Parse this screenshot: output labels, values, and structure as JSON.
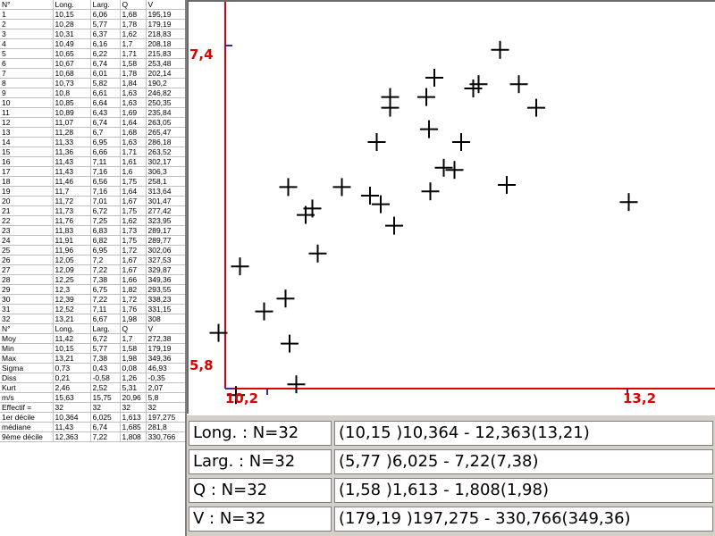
{
  "table": {
    "header": [
      "N°",
      "Long.",
      "Larg.",
      "Q",
      "V"
    ],
    "rows": [
      [
        "1",
        "10,15",
        "6,06",
        "1,68",
        "195,19"
      ],
      [
        "2",
        "10,28",
        "5,77",
        "1,78",
        "179,19"
      ],
      [
        "3",
        "10,31",
        "6,37",
        "1,62",
        "218,83"
      ],
      [
        "4",
        "10,49",
        "6,16",
        "1,7",
        "208,18"
      ],
      [
        "5",
        "10,65",
        "6,22",
        "1,71",
        "215,83"
      ],
      [
        "6",
        "10,67",
        "6,74",
        "1,58",
        "253,48"
      ],
      [
        "7",
        "10,68",
        "6,01",
        "1,78",
        "202,14"
      ],
      [
        "8",
        "10,73",
        "5,82",
        "1,84",
        "190,2"
      ],
      [
        "9",
        "10,8",
        "6,61",
        "1,63",
        "246,82"
      ],
      [
        "10",
        "10,85",
        "6,64",
        "1,63",
        "250,35"
      ],
      [
        "11",
        "10,89",
        "6,43",
        "1,69",
        "235,84"
      ],
      [
        "12",
        "11,07",
        "6,74",
        "1,64",
        "263,05"
      ],
      [
        "13",
        "11,28",
        "6,7",
        "1,68",
        "265,47"
      ],
      [
        "14",
        "11,33",
        "6,95",
        "1,63",
        "286,18"
      ],
      [
        "15",
        "11,36",
        "6,66",
        "1,71",
        "263,52"
      ],
      [
        "16",
        "11,43",
        "7,11",
        "1,61",
        "302,17"
      ],
      [
        "17",
        "11,43",
        "7,16",
        "1,6",
        "306,3"
      ],
      [
        "18",
        "11,46",
        "6,56",
        "1,75",
        "258,1"
      ],
      [
        "19",
        "11,7",
        "7,16",
        "1,64",
        "313,64"
      ],
      [
        "20",
        "11,72",
        "7,01",
        "1,67",
        "301,47"
      ],
      [
        "21",
        "11,73",
        "6,72",
        "1,75",
        "277,42"
      ],
      [
        "22",
        "11,76",
        "7,25",
        "1,62",
        "323,95"
      ],
      [
        "23",
        "11,83",
        "6,83",
        "1,73",
        "289,17"
      ],
      [
        "24",
        "11,91",
        "6,82",
        "1,75",
        "289,77"
      ],
      [
        "25",
        "11,96",
        "6,95",
        "1,72",
        "302,06"
      ],
      [
        "26",
        "12,05",
        "7,2",
        "1,67",
        "327,53"
      ],
      [
        "27",
        "12,09",
        "7,22",
        "1,67",
        "329,87"
      ],
      [
        "28",
        "12,25",
        "7,38",
        "1,66",
        "349,36"
      ],
      [
        "29",
        "12,3",
        "6,75",
        "1,82",
        "293,55"
      ],
      [
        "30",
        "12,39",
        "7,22",
        "1,72",
        "338,23"
      ],
      [
        "31",
        "12,52",
        "7,11",
        "1,76",
        "331,15"
      ],
      [
        "32",
        "13,21",
        "6,67",
        "1,98",
        "308"
      ],
      [
        "N°",
        "Long.",
        "Larg.",
        "Q",
        "V"
      ],
      [
        "Moy",
        "11,42",
        "6,72",
        "1,7",
        "272,38"
      ],
      [
        "Min",
        "10,15",
        "5,77",
        "1,58",
        "179,19"
      ],
      [
        "Max",
        "13,21",
        "7,38",
        "1,98",
        "349,36"
      ],
      [
        "Sigma",
        "0,73",
        "0,43",
        "0,08",
        "46,93"
      ],
      [
        "Diss",
        "0,21",
        "-0,58",
        "1,26",
        "-0,35"
      ],
      [
        "Kurt",
        "2,46",
        "2,52",
        "5,31",
        "2,07"
      ],
      [
        "m/s",
        "15,63",
        "15,75",
        "20,96",
        "5,8"
      ],
      [
        "Effectif =",
        "32",
        "32",
        "32",
        "32"
      ],
      [
        "1er décile",
        "10,364",
        "6,025",
        "1,613",
        "197,275"
      ],
      [
        "médiane",
        "11,43",
        "6,74",
        "1,685",
        "281,8"
      ],
      [
        "9ème décile",
        "12,363",
        "7,22",
        "1,808",
        "330,766"
      ]
    ]
  },
  "chart_data": {
    "type": "scatter",
    "marker": "plus",
    "x_axis_variable": "Long.",
    "y_axis_variable": "Larg.",
    "xlim": [
      10.2,
      13.2
    ],
    "ylim": [
      5.8,
      7.4
    ],
    "x_tick_labels": [
      "10,2",
      "13,2"
    ],
    "y_tick_labels": [
      "7,4",
      "5,8"
    ],
    "axis_color": "#e00000",
    "marker_color": "#000000",
    "points": [
      [
        10.15,
        6.06
      ],
      [
        10.28,
        5.77
      ],
      [
        10.31,
        6.37
      ],
      [
        10.49,
        6.16
      ],
      [
        10.65,
        6.22
      ],
      [
        10.67,
        6.74
      ],
      [
        10.68,
        6.01
      ],
      [
        10.73,
        5.82
      ],
      [
        10.8,
        6.61
      ],
      [
        10.85,
        6.64
      ],
      [
        10.89,
        6.43
      ],
      [
        11.07,
        6.74
      ],
      [
        11.28,
        6.7
      ],
      [
        11.33,
        6.95
      ],
      [
        11.36,
        6.66
      ],
      [
        11.43,
        7.11
      ],
      [
        11.43,
        7.16
      ],
      [
        11.46,
        6.56
      ],
      [
        11.7,
        7.16
      ],
      [
        11.72,
        7.01
      ],
      [
        11.73,
        6.72
      ],
      [
        11.76,
        7.25
      ],
      [
        11.83,
        6.83
      ],
      [
        11.91,
        6.82
      ],
      [
        11.96,
        6.95
      ],
      [
        12.05,
        7.2
      ],
      [
        12.09,
        7.22
      ],
      [
        12.25,
        7.38
      ],
      [
        12.3,
        6.75
      ],
      [
        12.39,
        7.22
      ],
      [
        12.52,
        7.11
      ],
      [
        13.21,
        6.67
      ]
    ]
  },
  "summary": [
    {
      "label": "Long. : N=32",
      "range": "(10,15 )10,364 - 12,363(13,21)"
    },
    {
      "label": "Larg. : N=32",
      "range": "(5,77 )6,025 - 7,22(7,38)"
    },
    {
      "label": "Q : N=32",
      "range": "(1,58 )1,613 - 1,808(1,98)"
    },
    {
      "label": "V : N=32",
      "range": "(179,19 )197,275 - 330,766(349,36)"
    }
  ]
}
